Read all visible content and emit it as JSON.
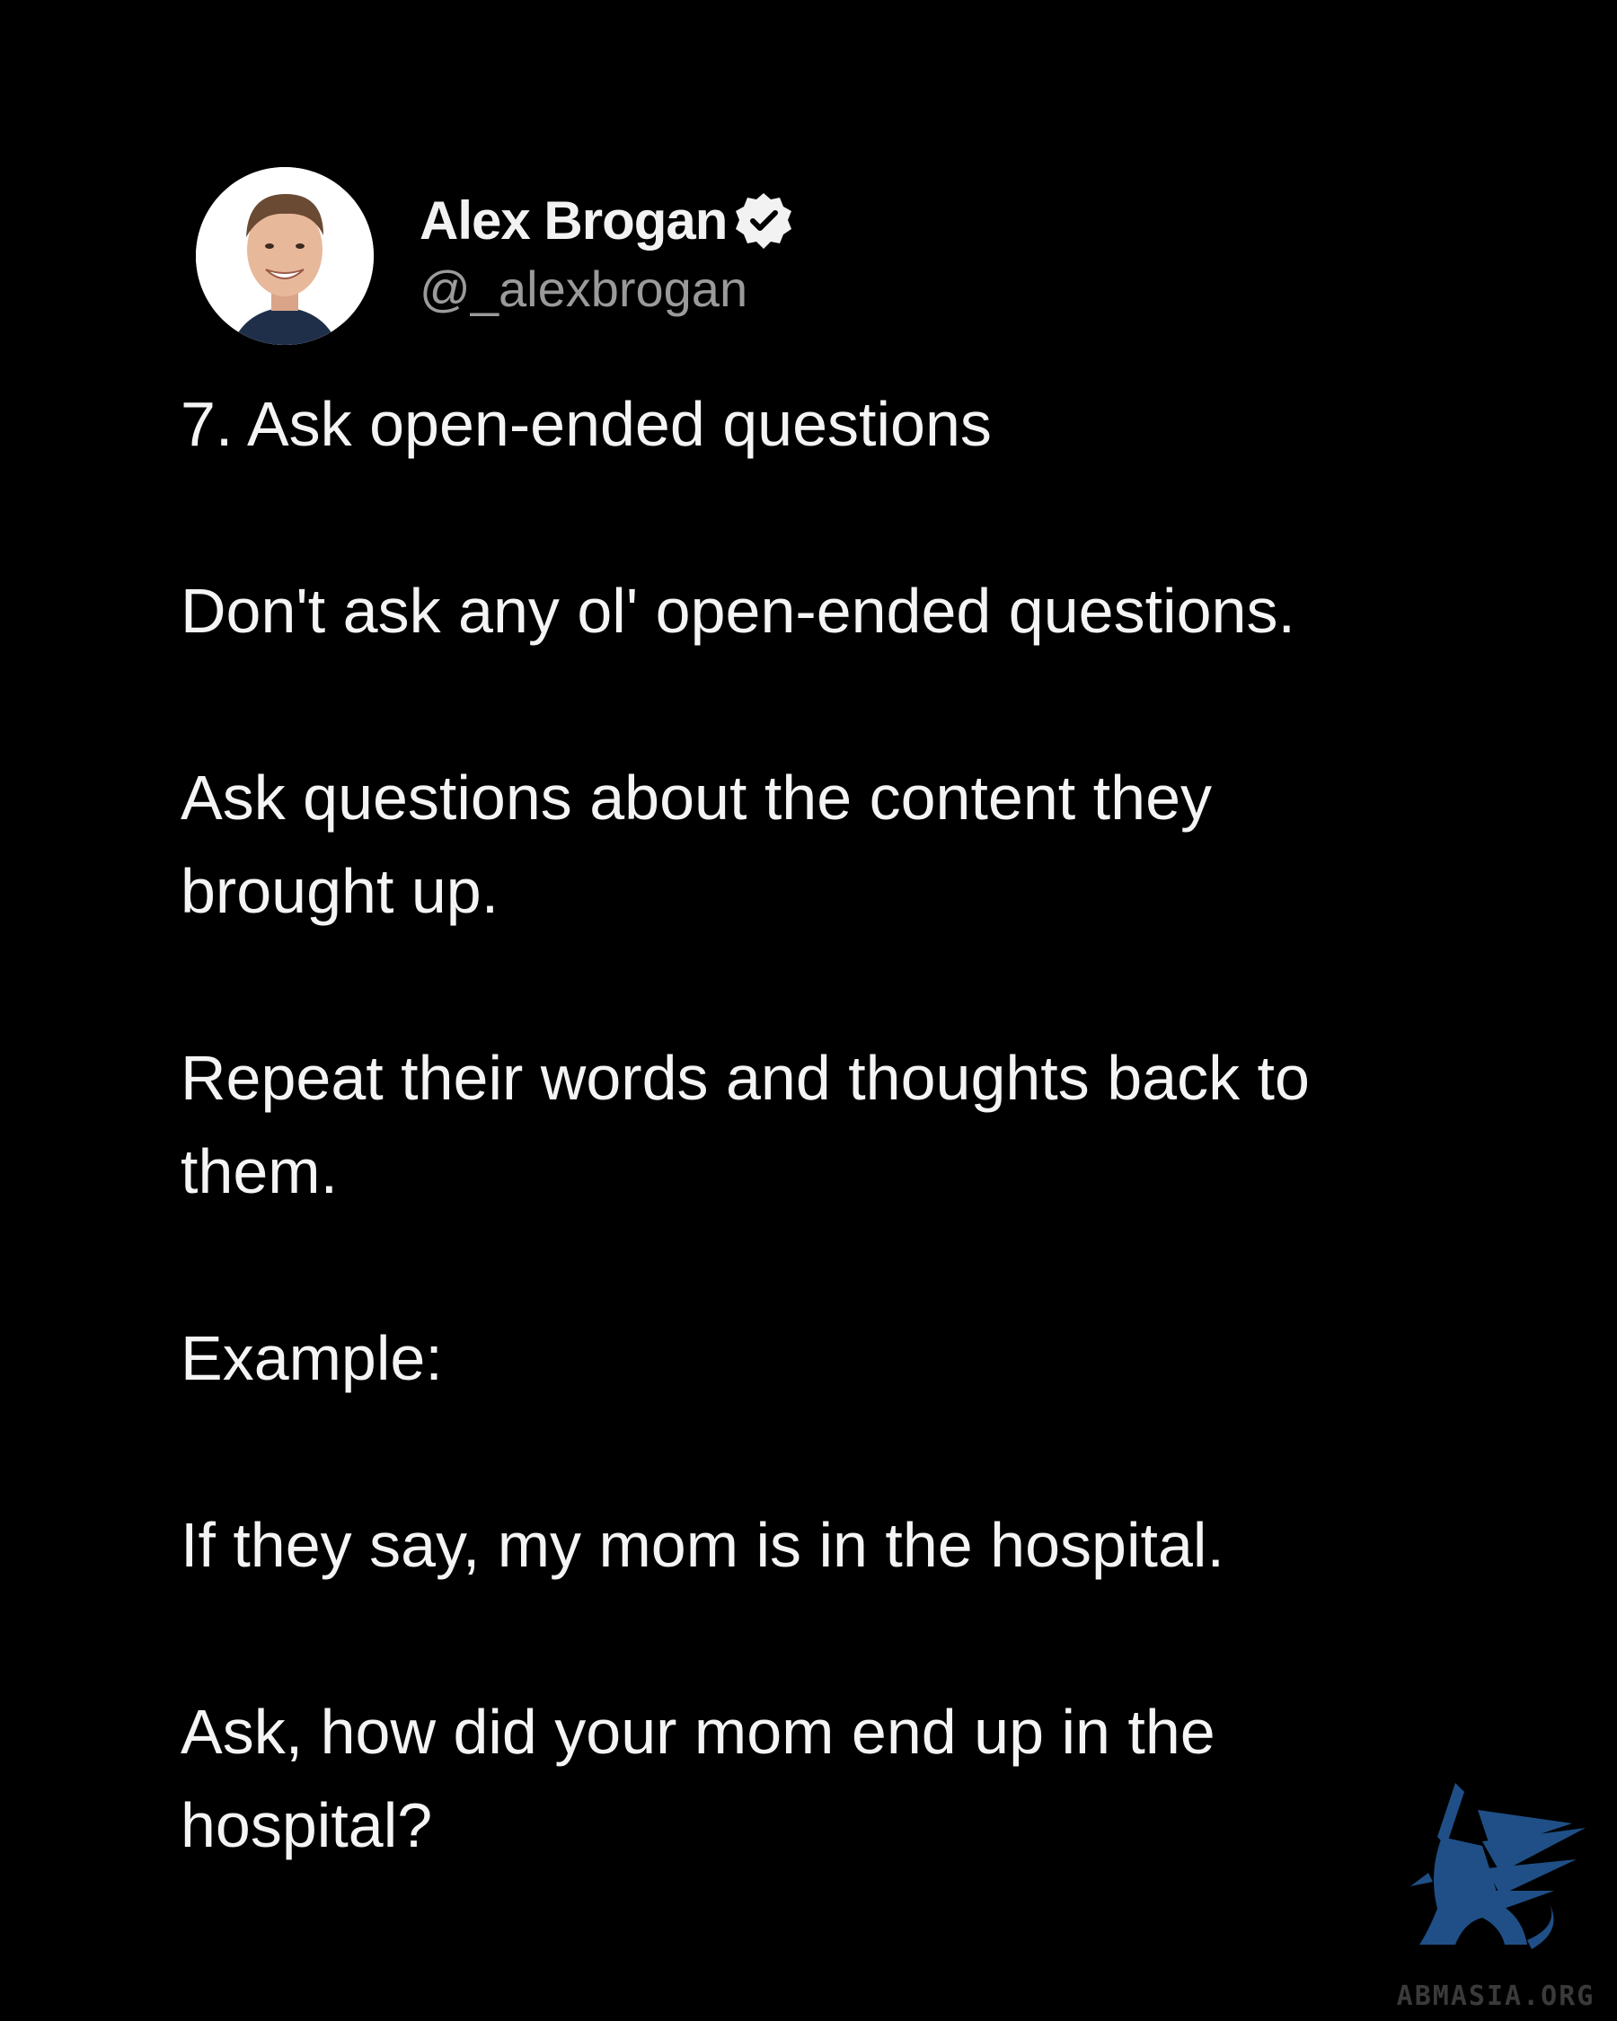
{
  "author": {
    "name": "Alex Brogan",
    "handle": "@_alexbrogan",
    "verified": true
  },
  "icons": {
    "avatar": "avatar-photo",
    "verified": "verified-badge-icon",
    "watermark": "griffin-logo"
  },
  "post": {
    "paragraphs": [
      "7. Ask open-ended questions",
      "Don't ask any ol' open-ended questions.",
      "Ask questions about the content they brought up.",
      "Repeat their words and thoughts back to them.",
      "Example:",
      "If they say, my mom is in the hospital.",
      "Ask, how did your mom end up in the hospital?"
    ]
  },
  "watermark": {
    "text": "ABMASIA.ORG"
  },
  "colors": {
    "background": "#000000",
    "text": "#f4f4f4",
    "handle": "#9a9a9a",
    "watermark_blue": "#1f4f86"
  }
}
